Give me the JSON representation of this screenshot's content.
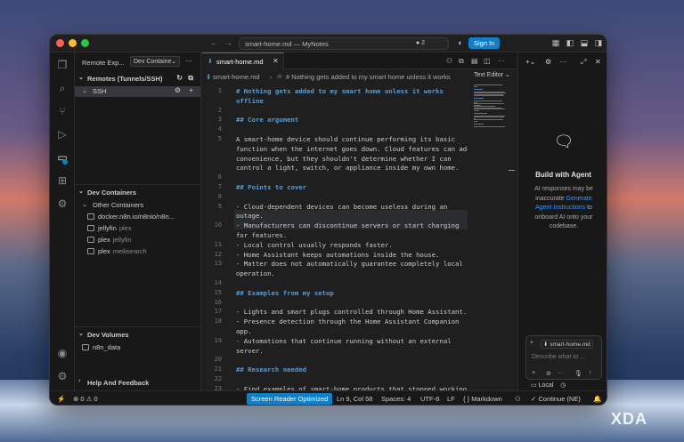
{
  "titlebar": {
    "title": "smart-home.md — MyNotes",
    "notification_count": "2",
    "signin_label": "Sign In"
  },
  "sidebar": {
    "title": "Remote Exp...",
    "selector_value": "Dev Containe",
    "sections": {
      "remotes": {
        "title": "Remotes (Tunnels/SSH)",
        "ssh_label": "SSH"
      },
      "containers": {
        "title": "Dev Containers",
        "group": "Other Containers",
        "items": [
          {
            "name": "docker.n8n.io/n8nio/n8n...",
            "desc": ""
          },
          {
            "name": "jellyfin",
            "desc": "plex"
          },
          {
            "name": "plex",
            "desc": "jellyfin"
          },
          {
            "name": "plex",
            "desc": "meilisearch"
          }
        ]
      },
      "volumes": {
        "title": "Dev Volumes",
        "items": [
          "n8n_data"
        ]
      },
      "help": {
        "title": "Help And Feedback"
      }
    }
  },
  "editor": {
    "tab_label": "smart-home.md",
    "breadcrumb_file": "smart-home.md",
    "breadcrumb_heading": "# Nothing gets added to my smart home unless it works",
    "text_editor_label": "Text Editor",
    "lines": [
      {
        "n": "1",
        "text": "# Nothing gets added to my smart home unless it works",
        "h": true
      },
      {
        "n": "",
        "text": "offline",
        "h": true
      },
      {
        "n": "2",
        "text": "",
        "h": false
      },
      {
        "n": "3",
        "text": "## Core argument",
        "h": true
      },
      {
        "n": "4",
        "text": "",
        "h": false
      },
      {
        "n": "5",
        "text": "A smart-home device should continue performing its basic",
        "h": false
      },
      {
        "n": "",
        "text": "function when the internet goes down. Cloud features can add",
        "h": false
      },
      {
        "n": "",
        "text": "convenience, but they shouldn't determine whether I can",
        "h": false
      },
      {
        "n": "",
        "text": "control a light, switch, or appliance inside my own home.",
        "h": false
      },
      {
        "n": "6",
        "text": "",
        "h": false
      },
      {
        "n": "7",
        "text": "## Points to cover",
        "h": true
      },
      {
        "n": "8",
        "text": "",
        "h": false
      },
      {
        "n": "9",
        "text": "- Cloud-dependent devices can become useless during an",
        "h": false
      },
      {
        "n": "",
        "text": "outage.",
        "h": false
      },
      {
        "n": "10",
        "text": "- Manufacturers can discontinue servers or start charging",
        "h": false
      },
      {
        "n": "",
        "text": "for features.",
        "h": false
      },
      {
        "n": "11",
        "text": "- Local control usually responds faster.",
        "h": false
      },
      {
        "n": "12",
        "text": "- Home Assistant keeps automations inside the house.",
        "h": false
      },
      {
        "n": "13",
        "text": "- Matter does not automatically guarantee completely local",
        "h": false
      },
      {
        "n": "",
        "text": "operation.",
        "h": false
      },
      {
        "n": "14",
        "text": "",
        "h": false
      },
      {
        "n": "15",
        "text": "## Examples from my setup",
        "h": true
      },
      {
        "n": "16",
        "text": "",
        "h": false
      },
      {
        "n": "17",
        "text": "- Lights and smart plugs controlled through Home Assistant.",
        "h": false
      },
      {
        "n": "18",
        "text": "- Presence detection through the Home Assistant Companion",
        "h": false
      },
      {
        "n": "",
        "text": "app.",
        "h": false
      },
      {
        "n": "19",
        "text": "- Automations that continue running without an external",
        "h": false
      },
      {
        "n": "",
        "text": "server.",
        "h": false
      },
      {
        "n": "20",
        "text": "",
        "h": false
      },
      {
        "n": "21",
        "text": "## Research needed",
        "h": true
      },
      {
        "n": "22",
        "text": "",
        "h": false
      },
      {
        "n": "23",
        "text": "- Find examples of smart-home products that stopped working",
        "h": false
      }
    ]
  },
  "chat": {
    "title": "Build with Agent",
    "desc_before": "AI responses may be inaccurate",
    "desc_link": "Generate Agent Instructions",
    "desc_after": "to onboard AI onto your codebase.",
    "context_chip": "smart-home.md",
    "placeholder": "Describe what to ...",
    "mode_label": "Local"
  },
  "statusbar": {
    "errors": "0",
    "warnings": "0",
    "screen_reader": "Screen Reader Optimized",
    "position": "Ln 9, Col 58",
    "spaces": "Spaces: 4",
    "encoding": "UTF-8",
    "eol": "LF",
    "language": "Markdown",
    "continue": "Continue (NE)"
  },
  "watermark": "XDA"
}
